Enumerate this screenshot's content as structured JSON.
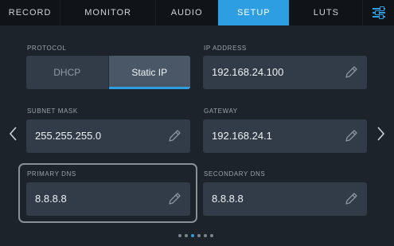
{
  "tabs": [
    {
      "label": "RECORD",
      "active": false
    },
    {
      "label": "MONITOR",
      "active": false
    },
    {
      "label": "AUDIO",
      "active": false
    },
    {
      "label": "SETUP",
      "active": true
    },
    {
      "label": "LUTS",
      "active": false
    }
  ],
  "menu_icon": "sliders-icon",
  "protocol": {
    "label": "PROTOCOL",
    "options": [
      "DHCP",
      "Static IP"
    ],
    "selected": "Static IP"
  },
  "ip_address": {
    "label": "IP ADDRESS",
    "value": "192.168.24.100"
  },
  "subnet_mask": {
    "label": "SUBNET MASK",
    "value": "255.255.255.0"
  },
  "gateway": {
    "label": "GATEWAY",
    "value": "192.168.24.1"
  },
  "primary_dns": {
    "label": "PRIMARY DNS",
    "value": "8.8.8.8"
  },
  "secondary_dns": {
    "label": "SECONDARY DNS",
    "value": "8.8.8.8"
  },
  "pagination": {
    "total": 6,
    "current": 3
  },
  "colors": {
    "accent": "#2d9ee2",
    "background": "#1d232b",
    "field": "#323c48",
    "tabbar": "#101317"
  }
}
